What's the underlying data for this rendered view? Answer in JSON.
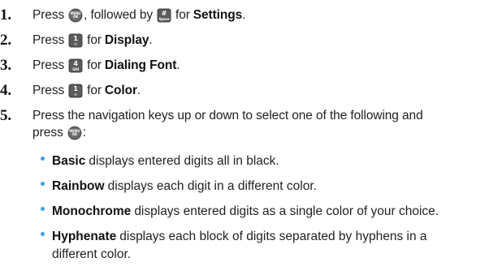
{
  "steps": [
    {
      "number": "1.",
      "parts": {
        "press": "Press",
        "mid": ", followed by",
        "for": "for",
        "target": "Settings",
        "end": "."
      },
      "keys": [
        {
          "icon": "menu-ok-key-icon",
          "top": "MENU",
          "bottom": "OK"
        },
        {
          "icon": "pound-space-key-icon",
          "top": "#",
          "bottom": "Space"
        }
      ]
    },
    {
      "number": "2.",
      "parts": {
        "press": "Press",
        "for": "for",
        "target": "Display",
        "end": "."
      },
      "keys": [
        {
          "icon": "one-key-icon",
          "top": "1",
          "bottom": "✉"
        }
      ]
    },
    {
      "number": "3.",
      "parts": {
        "press": "Press",
        "for": "for",
        "target": "Dialing Font",
        "end": "."
      },
      "keys": [
        {
          "icon": "four-key-icon",
          "top": "4",
          "bottom": "GHI"
        }
      ]
    },
    {
      "number": "4.",
      "parts": {
        "press": "Press",
        "for": "for",
        "target": "Color",
        "end": "."
      },
      "keys": [
        {
          "icon": "one-key-icon",
          "top": "1",
          "bottom": "✉"
        }
      ]
    },
    {
      "number": "5.",
      "line1": "Press the navigation keys up or down to select one of the following and",
      "line2_pre": "press",
      "line2_end": ":",
      "keys": [
        {
          "icon": "menu-ok-key-icon",
          "top": "MENU",
          "bottom": "OK"
        }
      ]
    }
  ],
  "options": [
    {
      "term": "Basic",
      "desc": "displays entered digits all in black."
    },
    {
      "term": "Rainbow",
      "desc": "displays each digit in a different color."
    },
    {
      "term": "Monochrome",
      "desc": "displays entered digits as a single color of your choice."
    },
    {
      "term": "Hyphenate",
      "desc": "displays each block of digits separated by hyphens in a",
      "desc_cont": "different color."
    }
  ],
  "colors": {
    "bullet": "#3fa0e0",
    "key_round": "#5a5a5a",
    "key_square": "#4a4a4a"
  }
}
